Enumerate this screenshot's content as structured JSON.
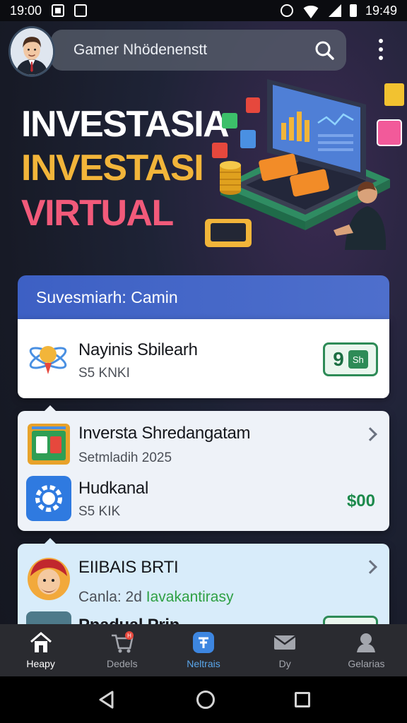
{
  "status_bar": {
    "time_left": "19:00",
    "time_right": "19:49",
    "icons": [
      "notification-icon",
      "image-icon",
      "alarm-icon",
      "wifi-icon",
      "signal-icon",
      "battery-icon"
    ]
  },
  "header": {
    "search_text": "Gamer Nhödenenstt",
    "icons": [
      "avatar",
      "search-icon",
      "more-vertical-icon"
    ]
  },
  "hero": {
    "line1": "INVESTASIA",
    "line2": "INVESTASI",
    "line3": "VIRTUAL",
    "colors": {
      "line1": "#ffffff",
      "line2": "#f2b53a",
      "line3": "#f25a7a"
    }
  },
  "section": {
    "title": "Suvesmiarh: Camin"
  },
  "items": [
    {
      "title": "Nayinis Sbilearh",
      "subtitle": "S5 KNKI",
      "badge_value": "9",
      "badge_suffix": "Sh",
      "icon": "atom-rocket-icon"
    },
    {
      "title": "Inversta Shredangatam",
      "subtitle": "Setmladih 2025",
      "icon": "chart-screen-icon"
    },
    {
      "title": "Hudkanal",
      "subtitle": "S5 KIK",
      "amount": "$00",
      "icon": "gear-icon"
    },
    {
      "title": "EIIBAIS BRTI",
      "subtitle_prefix": "Canla: 2d",
      "subtitle_highlight": "Iavakantirasy",
      "icon": "character-face-icon"
    },
    {
      "title": "Pnadual Prin",
      "icon": "tool-icon"
    }
  ],
  "bottom_nav": [
    {
      "label": "Heapy",
      "icon": "home-icon",
      "state": "active"
    },
    {
      "label": "Dedels",
      "icon": "cart-icon",
      "badge": "H"
    },
    {
      "label": "Neltrais",
      "icon": "finance-icon",
      "state": "highlight"
    },
    {
      "label": "Dy",
      "icon": "mail-icon"
    },
    {
      "label": "Gelarias",
      "icon": "profile-icon"
    }
  ],
  "accent_colors": {
    "banner": "#3d60c4",
    "money": "#1d8a4c",
    "nav_bg": "#2a2b30"
  }
}
